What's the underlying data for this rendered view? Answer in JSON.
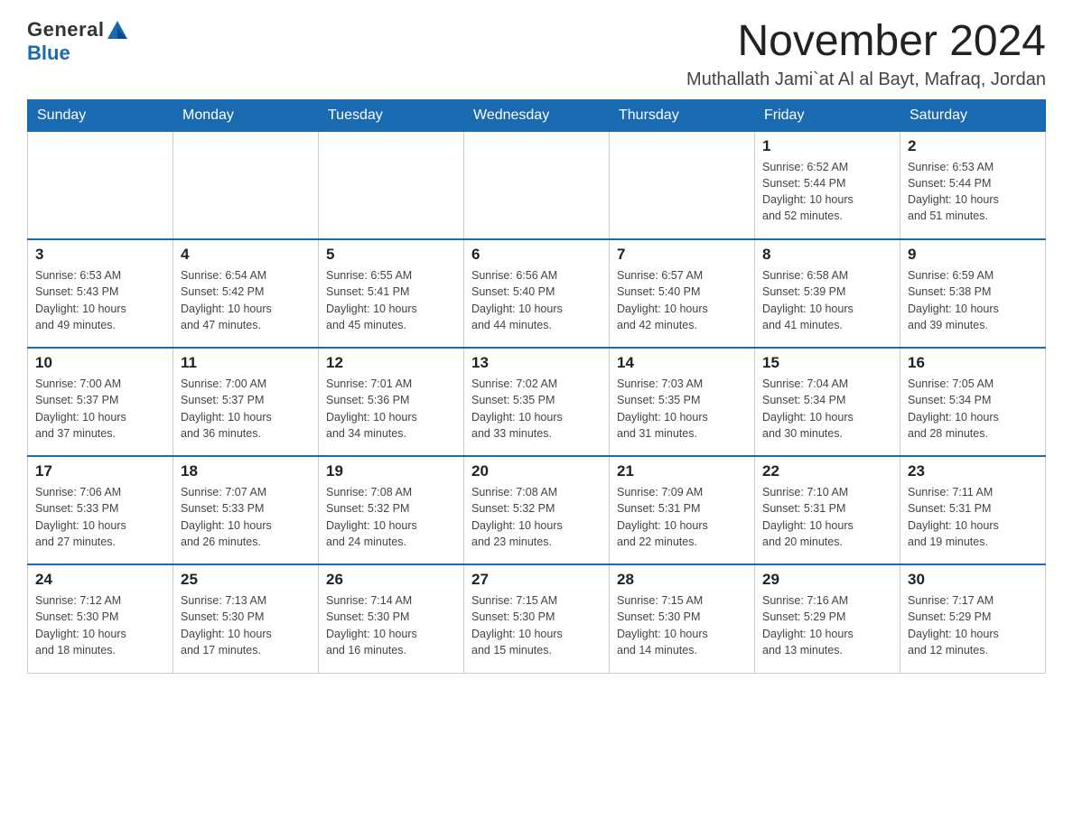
{
  "header": {
    "logo_general": "General",
    "logo_blue": "Blue",
    "month_title": "November 2024",
    "location": "Muthallath Jami`at Al al Bayt, Mafraq, Jordan"
  },
  "days_of_week": [
    "Sunday",
    "Monday",
    "Tuesday",
    "Wednesday",
    "Thursday",
    "Friday",
    "Saturday"
  ],
  "weeks": [
    [
      {
        "day": "",
        "info": ""
      },
      {
        "day": "",
        "info": ""
      },
      {
        "day": "",
        "info": ""
      },
      {
        "day": "",
        "info": ""
      },
      {
        "day": "",
        "info": ""
      },
      {
        "day": "1",
        "info": "Sunrise: 6:52 AM\nSunset: 5:44 PM\nDaylight: 10 hours\nand 52 minutes."
      },
      {
        "day": "2",
        "info": "Sunrise: 6:53 AM\nSunset: 5:44 PM\nDaylight: 10 hours\nand 51 minutes."
      }
    ],
    [
      {
        "day": "3",
        "info": "Sunrise: 6:53 AM\nSunset: 5:43 PM\nDaylight: 10 hours\nand 49 minutes."
      },
      {
        "day": "4",
        "info": "Sunrise: 6:54 AM\nSunset: 5:42 PM\nDaylight: 10 hours\nand 47 minutes."
      },
      {
        "day": "5",
        "info": "Sunrise: 6:55 AM\nSunset: 5:41 PM\nDaylight: 10 hours\nand 45 minutes."
      },
      {
        "day": "6",
        "info": "Sunrise: 6:56 AM\nSunset: 5:40 PM\nDaylight: 10 hours\nand 44 minutes."
      },
      {
        "day": "7",
        "info": "Sunrise: 6:57 AM\nSunset: 5:40 PM\nDaylight: 10 hours\nand 42 minutes."
      },
      {
        "day": "8",
        "info": "Sunrise: 6:58 AM\nSunset: 5:39 PM\nDaylight: 10 hours\nand 41 minutes."
      },
      {
        "day": "9",
        "info": "Sunrise: 6:59 AM\nSunset: 5:38 PM\nDaylight: 10 hours\nand 39 minutes."
      }
    ],
    [
      {
        "day": "10",
        "info": "Sunrise: 7:00 AM\nSunset: 5:37 PM\nDaylight: 10 hours\nand 37 minutes."
      },
      {
        "day": "11",
        "info": "Sunrise: 7:00 AM\nSunset: 5:37 PM\nDaylight: 10 hours\nand 36 minutes."
      },
      {
        "day": "12",
        "info": "Sunrise: 7:01 AM\nSunset: 5:36 PM\nDaylight: 10 hours\nand 34 minutes."
      },
      {
        "day": "13",
        "info": "Sunrise: 7:02 AM\nSunset: 5:35 PM\nDaylight: 10 hours\nand 33 minutes."
      },
      {
        "day": "14",
        "info": "Sunrise: 7:03 AM\nSunset: 5:35 PM\nDaylight: 10 hours\nand 31 minutes."
      },
      {
        "day": "15",
        "info": "Sunrise: 7:04 AM\nSunset: 5:34 PM\nDaylight: 10 hours\nand 30 minutes."
      },
      {
        "day": "16",
        "info": "Sunrise: 7:05 AM\nSunset: 5:34 PM\nDaylight: 10 hours\nand 28 minutes."
      }
    ],
    [
      {
        "day": "17",
        "info": "Sunrise: 7:06 AM\nSunset: 5:33 PM\nDaylight: 10 hours\nand 27 minutes."
      },
      {
        "day": "18",
        "info": "Sunrise: 7:07 AM\nSunset: 5:33 PM\nDaylight: 10 hours\nand 26 minutes."
      },
      {
        "day": "19",
        "info": "Sunrise: 7:08 AM\nSunset: 5:32 PM\nDaylight: 10 hours\nand 24 minutes."
      },
      {
        "day": "20",
        "info": "Sunrise: 7:08 AM\nSunset: 5:32 PM\nDaylight: 10 hours\nand 23 minutes."
      },
      {
        "day": "21",
        "info": "Sunrise: 7:09 AM\nSunset: 5:31 PM\nDaylight: 10 hours\nand 22 minutes."
      },
      {
        "day": "22",
        "info": "Sunrise: 7:10 AM\nSunset: 5:31 PM\nDaylight: 10 hours\nand 20 minutes."
      },
      {
        "day": "23",
        "info": "Sunrise: 7:11 AM\nSunset: 5:31 PM\nDaylight: 10 hours\nand 19 minutes."
      }
    ],
    [
      {
        "day": "24",
        "info": "Sunrise: 7:12 AM\nSunset: 5:30 PM\nDaylight: 10 hours\nand 18 minutes."
      },
      {
        "day": "25",
        "info": "Sunrise: 7:13 AM\nSunset: 5:30 PM\nDaylight: 10 hours\nand 17 minutes."
      },
      {
        "day": "26",
        "info": "Sunrise: 7:14 AM\nSunset: 5:30 PM\nDaylight: 10 hours\nand 16 minutes."
      },
      {
        "day": "27",
        "info": "Sunrise: 7:15 AM\nSunset: 5:30 PM\nDaylight: 10 hours\nand 15 minutes."
      },
      {
        "day": "28",
        "info": "Sunrise: 7:15 AM\nSunset: 5:30 PM\nDaylight: 10 hours\nand 14 minutes."
      },
      {
        "day": "29",
        "info": "Sunrise: 7:16 AM\nSunset: 5:29 PM\nDaylight: 10 hours\nand 13 minutes."
      },
      {
        "day": "30",
        "info": "Sunrise: 7:17 AM\nSunset: 5:29 PM\nDaylight: 10 hours\nand 12 minutes."
      }
    ]
  ]
}
